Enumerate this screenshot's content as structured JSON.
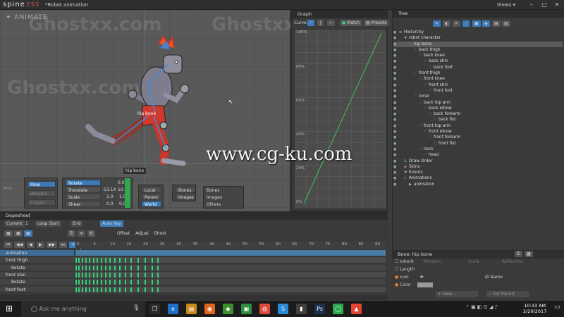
{
  "titlebar": {
    "logo_main": "spine",
    "logo_suffix": "ESS",
    "document": "*Robot animation",
    "views": "Views",
    "views_caret": "▾"
  },
  "viewport": {
    "mode": "ANIMATE",
    "bone_label": "hip bone",
    "selected_bone_tag": "hip bone"
  },
  "watermarks": {
    "ghost": "Ghostxx.com",
    "cgku": "www.cg-ku.com"
  },
  "tools": {
    "pose_group": [
      "Pose",
      "Weights",
      "Create"
    ],
    "pose_group_title": "Tools",
    "transform": [
      {
        "label": "Rotate",
        "value1": "",
        "value2": "0.0"
      },
      {
        "label": "Translate",
        "value1": "-13.14",
        "value2": "10.74"
      },
      {
        "label": "Scale",
        "value1": "1.0",
        "value2": "1.0"
      },
      {
        "label": "Shear",
        "value1": "0.0",
        "value2": "0.0"
      }
    ],
    "transform_title": "Transform",
    "axes": [
      "Local",
      "Parent",
      "World"
    ],
    "axes_title": "Axes",
    "compensate": [
      "Bones",
      "Images"
    ],
    "compensate_title": "Compensate",
    "options": [
      "Bones",
      "Images",
      "Others"
    ],
    "options_title": "Options"
  },
  "graph": {
    "title": "Graph",
    "curve_label": "Curve:",
    "match": "Match",
    "presets": "Presets",
    "ticks": [
      "100%",
      "80%",
      "60%",
      "40%",
      "20%",
      "0%"
    ]
  },
  "tree": {
    "title": "Tree",
    "items": [
      {
        "label": "Hierarchy",
        "depth": 0,
        "icon": "list-icon"
      },
      {
        "label": "robot character",
        "depth": 1,
        "icon": "skeleton-icon"
      },
      {
        "label": "hip bone",
        "depth": 2,
        "icon": "bone-icon",
        "selected": true
      },
      {
        "label": "back thigh",
        "depth": 3,
        "icon": "bone-icon"
      },
      {
        "label": "back knee",
        "depth": 4,
        "icon": "bone-icon"
      },
      {
        "label": "back shin",
        "depth": 5,
        "icon": "bone-icon"
      },
      {
        "label": "back foot",
        "depth": 6,
        "icon": "bone-icon"
      },
      {
        "label": "front thigh",
        "depth": 3,
        "icon": "bone-icon"
      },
      {
        "label": "front knee",
        "depth": 4,
        "icon": "bone-icon"
      },
      {
        "label": "front shin",
        "depth": 5,
        "icon": "bone-icon"
      },
      {
        "label": "front foot",
        "depth": 6,
        "icon": "bone-icon"
      },
      {
        "label": "torso",
        "depth": 3,
        "icon": "bone-icon"
      },
      {
        "label": "back top arm",
        "depth": 4,
        "icon": "bone-icon"
      },
      {
        "label": "back elbow",
        "depth": 5,
        "icon": "bone-icon"
      },
      {
        "label": "back forearm",
        "depth": 6,
        "icon": "bone-icon"
      },
      {
        "label": "back fist",
        "depth": 7,
        "icon": "bone-icon"
      },
      {
        "label": "front top arm",
        "depth": 4,
        "icon": "bone-icon"
      },
      {
        "label": "front elbow",
        "depth": 5,
        "icon": "bone-icon"
      },
      {
        "label": "front forearm",
        "depth": 6,
        "icon": "bone-icon"
      },
      {
        "label": "front fist",
        "depth": 7,
        "icon": "bone-icon"
      },
      {
        "label": "neck",
        "depth": 4,
        "icon": "bone-icon"
      },
      {
        "label": "head",
        "depth": 5,
        "icon": "bone-icon"
      },
      {
        "label": "Draw Order",
        "depth": 1,
        "icon": "draw-order-icon"
      },
      {
        "label": "Skins",
        "depth": 1,
        "icon": "skins-icon"
      },
      {
        "label": "Events",
        "depth": 1,
        "icon": "events-icon"
      },
      {
        "label": "Animations",
        "depth": 1,
        "icon": "animations-icon"
      },
      {
        "label": "animation",
        "depth": 2,
        "icon": "animation-icon"
      }
    ]
  },
  "props": {
    "title": "Bone: hip bone",
    "inherit_label": "Inherit",
    "inherit_options": [
      "Rotation",
      "Scale",
      "Reflection"
    ],
    "length_label": "Length",
    "icon_label": "Icon",
    "name_label": "Name",
    "color_label": "Color",
    "new_label": "New...",
    "set_parent": "Set Parent"
  },
  "dopesheet": {
    "title": "Dopesheet",
    "controls": [
      "Current",
      "Loop Start",
      "End"
    ],
    "current_value": "1",
    "auto_key": "Auto Key",
    "opts": [
      "Offset",
      "Adjust",
      "Ghost"
    ],
    "frame_ticks": [
      "0",
      "5",
      "10",
      "15",
      "20",
      "25",
      "30",
      "35",
      "40",
      "45",
      "50",
      "55",
      "60",
      "65",
      "70",
      "75",
      "80",
      "85",
      "90"
    ],
    "rows": [
      {
        "label": "animation",
        "kind": "root"
      },
      {
        "label": "front thigh",
        "kind": "bone"
      },
      {
        "label": "Rotate",
        "kind": "prop"
      },
      {
        "label": "front shin",
        "kind": "bone"
      },
      {
        "label": "Rotate",
        "kind": "prop"
      },
      {
        "label": "front foot",
        "kind": "bone"
      }
    ]
  },
  "taskbar": {
    "search": "Ask me anything",
    "time": "10:33 AM",
    "date": "2/20/2017",
    "apps": [
      {
        "label": "❐",
        "color": "#2a2a2a"
      },
      {
        "label": "e",
        "color": "#1e6fc8"
      },
      {
        "label": "▤",
        "color": "#c98a1f"
      },
      {
        "label": "◉",
        "color": "#e1661b"
      },
      {
        "label": "◆",
        "color": "#3c8f2d"
      },
      {
        "label": "▣",
        "color": "#2f8f3f"
      },
      {
        "label": "◍",
        "color": "#dd4b39"
      },
      {
        "label": "S",
        "color": "#2a8ad4"
      },
      {
        "label": "▮",
        "color": "#3f3f3f"
      },
      {
        "label": "Ps",
        "color": "#1d2f4e"
      },
      {
        "label": "◯",
        "color": "#2ba94f"
      },
      {
        "label": "▲",
        "color": "#e0452f"
      }
    ]
  }
}
